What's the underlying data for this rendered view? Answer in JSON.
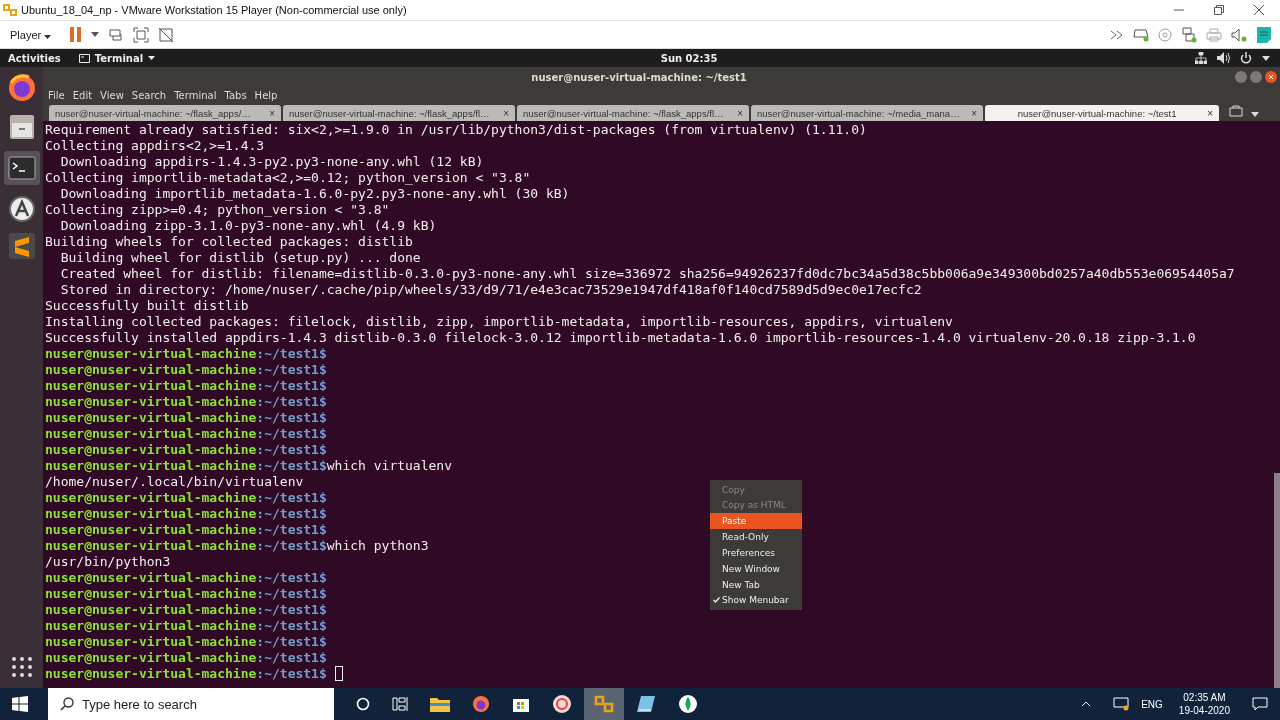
{
  "vmware": {
    "title": "Ubuntu_18_04_np - VMware Workstation 15 Player (Non-commercial use only)",
    "player_menu": "Player"
  },
  "ubuntu_bar": {
    "activities": "Activities",
    "app_menu": "Terminal",
    "clock": "Sun 02:35"
  },
  "terminal": {
    "title": "nuser@nuser-virtual-machine: ~/test1",
    "menu": [
      "File",
      "Edit",
      "View",
      "Search",
      "Terminal",
      "Tabs",
      "Help"
    ],
    "tabs": [
      {
        "label": "nuser@nuser-virtual-machine: ~/flask_apps/…",
        "close": "×",
        "selected": false
      },
      {
        "label": "nuser@nuser-virtual-machine: ~/flask_apps/fl…",
        "close": "×",
        "selected": false
      },
      {
        "label": "nuser@nuser-virtual-machine: ~/flask_apps/fl…",
        "close": "×",
        "selected": false
      },
      {
        "label": "nuser@nuser-virtual-machine: ~/media_mana…",
        "close": "×",
        "selected": false
      },
      {
        "label": "nuser@nuser-virtual-machine: ~/test1",
        "close": "×",
        "selected": true
      }
    ],
    "lines": [
      {
        "kind": "output",
        "text": "Requirement already satisfied: six<2,>=1.9.0 in /usr/lib/python3/dist-packages (from virtualenv) (1.11.0)"
      },
      {
        "kind": "output",
        "text": "Collecting appdirs<2,>=1.4.3"
      },
      {
        "kind": "output",
        "text": "  Downloading appdirs-1.4.3-py2.py3-none-any.whl (12 kB)"
      },
      {
        "kind": "output",
        "text": "Collecting importlib-metadata<2,>=0.12; python_version < \"3.8\""
      },
      {
        "kind": "output",
        "text": "  Downloading importlib_metadata-1.6.0-py2.py3-none-any.whl (30 kB)"
      },
      {
        "kind": "output",
        "text": "Collecting zipp>=0.4; python_version < \"3.8\""
      },
      {
        "kind": "output",
        "text": "  Downloading zipp-3.1.0-py3-none-any.whl (4.9 kB)"
      },
      {
        "kind": "output",
        "text": "Building wheels for collected packages: distlib"
      },
      {
        "kind": "output",
        "text": "  Building wheel for distlib (setup.py) ... done"
      },
      {
        "kind": "output",
        "text": "  Created wheel for distlib: filename=distlib-0.3.0-py3-none-any.whl size=336972 sha256=94926237fd0dc7bc34a5d38c5bb006a9e349300bd0257a40db553e06954405a7"
      },
      {
        "kind": "output",
        "text": "  Stored in directory: /home/nuser/.cache/pip/wheels/33/d9/71/e4e3cac73529e1947df418af0f140cd7589d5d9ec0e17ecfc2"
      },
      {
        "kind": "output",
        "text": "Successfully built distlib"
      },
      {
        "kind": "output",
        "text": "Installing collected packages: filelock, distlib, zipp, importlib-metadata, importlib-resources, appdirs, virtualenv"
      },
      {
        "kind": "output",
        "text": "Successfully installed appdirs-1.4.3 distlib-0.3.0 filelock-3.0.12 importlib-metadata-1.6.0 importlib-resources-1.4.0 virtualenv-20.0.18 zipp-3.1.0"
      },
      {
        "kind": "prompt",
        "user": "nuser@nuser-virtual-machine",
        "path": ":~/test1$"
      },
      {
        "kind": "prompt",
        "user": "nuser@nuser-virtual-machine",
        "path": ":~/test1$"
      },
      {
        "kind": "prompt",
        "user": "nuser@nuser-virtual-machine",
        "path": ":~/test1$"
      },
      {
        "kind": "prompt",
        "user": "nuser@nuser-virtual-machine",
        "path": ":~/test1$"
      },
      {
        "kind": "prompt",
        "user": "nuser@nuser-virtual-machine",
        "path": ":~/test1$"
      },
      {
        "kind": "prompt",
        "user": "nuser@nuser-virtual-machine",
        "path": ":~/test1$"
      },
      {
        "kind": "prompt",
        "user": "nuser@nuser-virtual-machine",
        "path": ":~/test1$"
      },
      {
        "kind": "prompt",
        "user": "nuser@nuser-virtual-machine",
        "path": ":~/test1$",
        "command": "which virtualenv"
      },
      {
        "kind": "output",
        "text": "/home/nuser/.local/bin/virtualenv"
      },
      {
        "kind": "prompt",
        "user": "nuser@nuser-virtual-machine",
        "path": ":~/test1$"
      },
      {
        "kind": "prompt",
        "user": "nuser@nuser-virtual-machine",
        "path": ":~/test1$"
      },
      {
        "kind": "prompt",
        "user": "nuser@nuser-virtual-machine",
        "path": ":~/test1$"
      },
      {
        "kind": "prompt",
        "user": "nuser@nuser-virtual-machine",
        "path": ":~/test1$",
        "command": "which python3"
      },
      {
        "kind": "output",
        "text": "/usr/bin/python3"
      },
      {
        "kind": "prompt",
        "user": "nuser@nuser-virtual-machine",
        "path": ":~/test1$"
      },
      {
        "kind": "prompt",
        "user": "nuser@nuser-virtual-machine",
        "path": ":~/test1$"
      },
      {
        "kind": "prompt",
        "user": "nuser@nuser-virtual-machine",
        "path": ":~/test1$"
      },
      {
        "kind": "prompt",
        "user": "nuser@nuser-virtual-machine",
        "path": ":~/test1$"
      },
      {
        "kind": "prompt",
        "user": "nuser@nuser-virtual-machine",
        "path": ":~/test1$"
      },
      {
        "kind": "prompt",
        "user": "nuser@nuser-virtual-machine",
        "path": ":~/test1$"
      },
      {
        "kind": "prompt",
        "user": "nuser@nuser-virtual-machine",
        "path": ":~/test1$",
        "cursor": true
      }
    ]
  },
  "context_menu": [
    {
      "label": "Copy",
      "disabled": true,
      "selected": false
    },
    {
      "label": "Copy as HTML",
      "disabled": true,
      "selected": false
    },
    {
      "label": "Paste",
      "disabled": false,
      "selected": true
    },
    {
      "label": "Read-Only",
      "disabled": false,
      "selected": false
    },
    {
      "label": "Preferences",
      "disabled": false,
      "selected": false
    },
    {
      "label": "New Window",
      "disabled": false,
      "selected": false
    },
    {
      "label": "New Tab",
      "disabled": false,
      "selected": false
    },
    {
      "label": "Show Menubar",
      "disabled": false,
      "selected": false,
      "checked": true
    }
  ],
  "taskbar": {
    "search_placeholder": "Type here to search",
    "language": "ENG",
    "time": "02:35 AM",
    "date": "19-04-2020"
  }
}
